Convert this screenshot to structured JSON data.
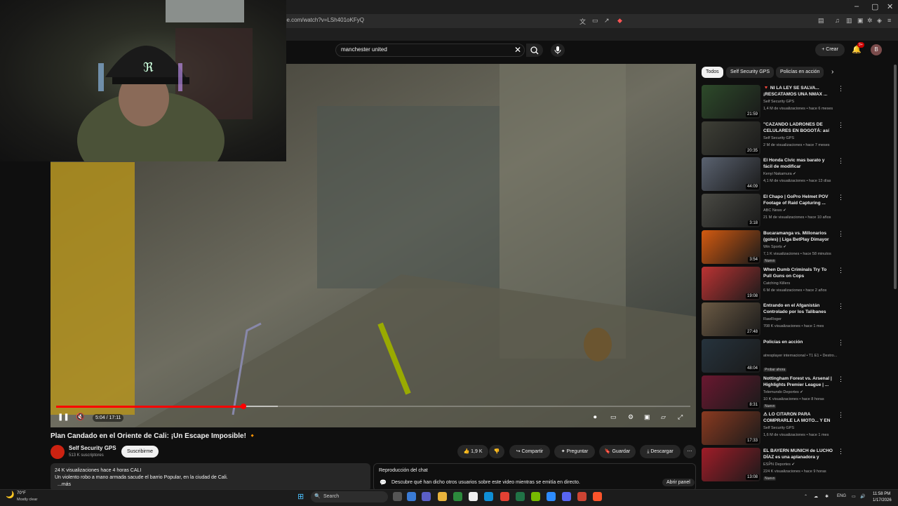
{
  "browser": {
    "url": "be.com/watch?v=LSh401oKFyQ",
    "window_controls": [
      "–",
      "▢",
      "✕"
    ]
  },
  "header": {
    "search_value": "manchester united",
    "create_label": "Crear",
    "notif_count": "9+",
    "avatar_initial": "B"
  },
  "player": {
    "time": "5:04 / 17:11",
    "progress_fraction": 0.295
  },
  "video": {
    "title": "Plan Candado en el Oriente de Cali: ¡Un Escape Imposible! 🔸",
    "channel": "Self Security GPS",
    "subs": "513 K suscriptores",
    "subscribe": "Suscribirme",
    "likes": "1,9 K",
    "share": "Compartir",
    "ask": "Preguntar",
    "save": "Guardar",
    "download": "Descargar"
  },
  "description": {
    "meta": "24 K visualizaciones  hace 4 horas  CALI",
    "text": "Un violento robo a mano armada sacude el barrio Popular, en la ciudad de Cali.",
    "more": "...más"
  },
  "chat": {
    "title": "Reproducción del chat",
    "text": "Descubre qué han dicho otros usuarios sobre este video mientras se emitía en directo.",
    "button": "Abrir panel"
  },
  "chips": [
    "Todos",
    "Self Security GPS",
    "Policías en acción"
  ],
  "recommendations": [
    {
      "title": "🔻 NI LA LEY SE SALVA... ¡RESCATAMOS UNA NMAX ...",
      "channel": "Self Security GPS",
      "meta": "1,4 M de visualizaciones • hace 6 meses",
      "duration": "21:59",
      "badge": "",
      "color": "#2d4a2a"
    },
    {
      "title": "\"CAZANDO LADRONES DE CELULARES EN BOGOTÁ: así ...",
      "channel": "Self Security GPS",
      "meta": "2 M de visualizaciones • hace 7 meses",
      "duration": "20:35",
      "badge": "",
      "color": "#3e3f36"
    },
    {
      "title": "El Honda Civic mas barato y fácil de modificar",
      "channel": "Kenyi Nakamura ✔",
      "meta": "4,1 M de visualizaciones • hace 13 días",
      "duration": "44:09",
      "badge": "",
      "color": "#5a6270"
    },
    {
      "title": "El Chapo | GoPro Helmet POV Footage of Raid Capturing ...",
      "channel": "ABC News ✔",
      "meta": "21 M de visualizaciones • hace 10 años",
      "duration": "3:18",
      "badge": "",
      "color": "#4a4a44"
    },
    {
      "title": "Bucaramanga vs. Millonarios (goles) | Liga BetPlay Dimayor ...",
      "channel": "Win Sports ✔",
      "meta": "7,1 K visualizaciones • hace 58 minutos",
      "duration": "3:54",
      "badge": "Nuevo",
      "color": "#d35a10"
    },
    {
      "title": "When Dumb Criminals Try To Pull Guns on Cops",
      "channel": "Catching Killers",
      "meta": "6 M de visualizaciones • hace 2 años",
      "duration": "19:08",
      "badge": "",
      "color": "#b33"
    },
    {
      "title": "Entrando en el Afganistán Controlado por los Talibanes",
      "channel": "RawRoger",
      "meta": "708 K visualizaciones • hace 1 mes",
      "duration": "27:48",
      "badge": "",
      "color": "#6b5a44"
    },
    {
      "title": "Policías en acción",
      "channel": "atresplayer internacional • T1 E1 • Destro...",
      "meta": "",
      "duration": "48:04",
      "badge": "Probar ahora",
      "color": "#26333d"
    },
    {
      "title": "Nottingham Forest vs. Arsenal | Highlights Premier League | ...",
      "channel": "Telemundo Deportes ✔",
      "meta": "10 K visualizaciones • hace 8 horas",
      "duration": "8:31",
      "badge": "Nuevo",
      "color": "#6a1830"
    },
    {
      "title": "⚠ LO CITARON PARA COMPRARLE LA MOTO... Y EN ...",
      "channel": "Self Security GPS",
      "meta": "1,6 M de visualizaciones • hace 1 mes",
      "duration": "17:33",
      "badge": "",
      "color": "#8a3a20"
    },
    {
      "title": "EL BAYERN MUNICH de LUCHO DÍAZ es una aplanadora y gole...",
      "channel": "ESPN Deportes ✔",
      "meta": "224 K visualizaciones • hace 9 horas",
      "duration": "13:08",
      "badge": "Nuevo",
      "color": "#a01c28"
    }
  ],
  "taskbar": {
    "temp": "70°F",
    "weather": "Mostly clear",
    "search": "Search",
    "lang": "ENG",
    "time": "11:58 PM",
    "date": "1/17/2026"
  }
}
